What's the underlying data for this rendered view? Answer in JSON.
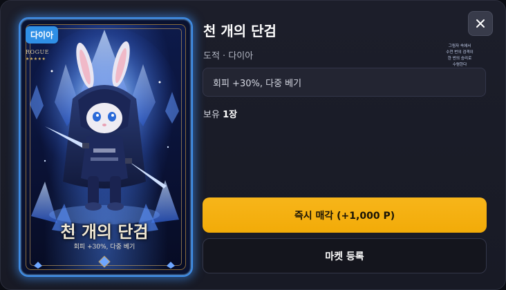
{
  "card": {
    "rarity": "다이아",
    "class_label": "ROGUE",
    "stars": "★★★★★",
    "flavor_lines": [
      "그림자 속에서",
      "수천 번의 검격이",
      "한 번의 승리로",
      "수렴한다"
    ],
    "title": "천 개의 단검",
    "effect": "회피 +30%, 다중 베기",
    "art_icon": "rabbit-rogue-with-daggers"
  },
  "item": {
    "title": "천 개의 단검",
    "meta": "도적 · 다이아",
    "effect": "회피 +30%, 다중 베기",
    "owned_label": "보유",
    "owned_count": "1장"
  },
  "actions": {
    "sell_label": "즉시 매각 (+1,000 P)",
    "market_label": "마켓 등록",
    "close_icon": "close-icon"
  },
  "colors": {
    "accent_gold": "#f2ab08",
    "rarity_blue": "#2f8fe6",
    "background": "#1c1e2a"
  }
}
